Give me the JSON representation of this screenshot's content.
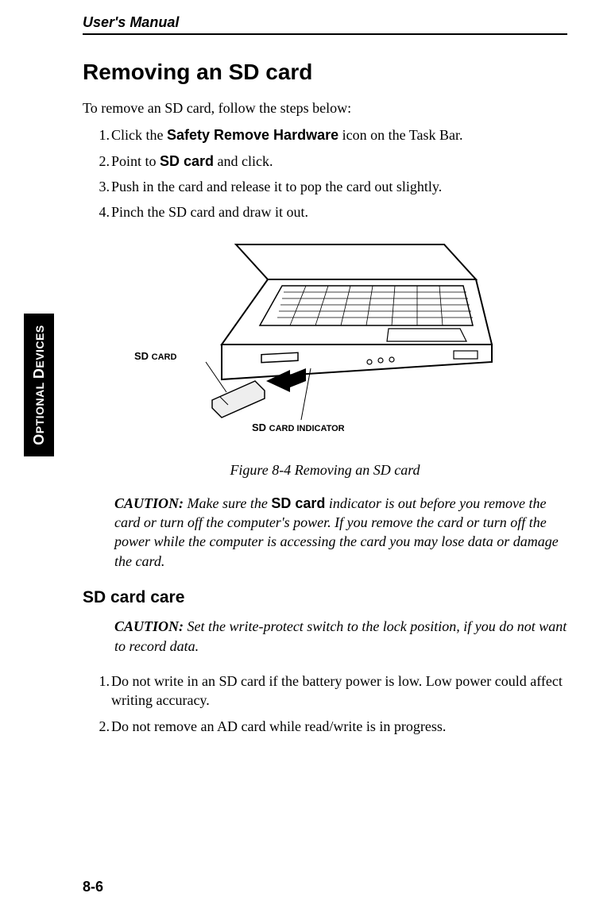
{
  "header": {
    "running_head": "User's Manual"
  },
  "side_tab": {
    "line1_big1": "O",
    "line1_rest1": "PTIONAL ",
    "line1_big2": "D",
    "line1_rest2": "EVICES"
  },
  "section": {
    "title": "Removing an SD card",
    "lead": "To remove an SD card, follow the steps below:",
    "steps": {
      "s1_a": "Click the ",
      "s1_bold": "Safety Remove Hardware",
      "s1_b": " icon on the Task Bar.",
      "s2_a": "Point to ",
      "s2_bold": "SD card",
      "s2_b": " and click.",
      "s3": "Push in the card and release it to pop the card out slightly.",
      "s4": "Pinch the SD card and draw it out."
    }
  },
  "figure": {
    "label_sd_big": "SD ",
    "label_sd_small": "CARD",
    "label_ind_big": "SD ",
    "label_ind_small": "CARD INDICATOR",
    "caption": "Figure 8-4  Removing an SD card"
  },
  "caution1": {
    "word": "CAUTION:",
    "a": " Make sure the ",
    "bold": "SD card",
    "b": " indicator is out before you remove the card or turn off the computer's power. If you remove the card or turn off the power while the computer is accessing the card you may lose data or damage the card."
  },
  "subsection": {
    "title": "SD card care"
  },
  "caution2": {
    "word": "CAUTION:",
    "text": " Set the write-protect switch to the lock position, if you do not want to record data."
  },
  "care_steps": {
    "s1": "Do not write in an SD card if the battery power is low. Low power could affect writing accuracy.",
    "s2": "Do not remove an AD card while read/write is in progress."
  },
  "page_number": "8-6"
}
